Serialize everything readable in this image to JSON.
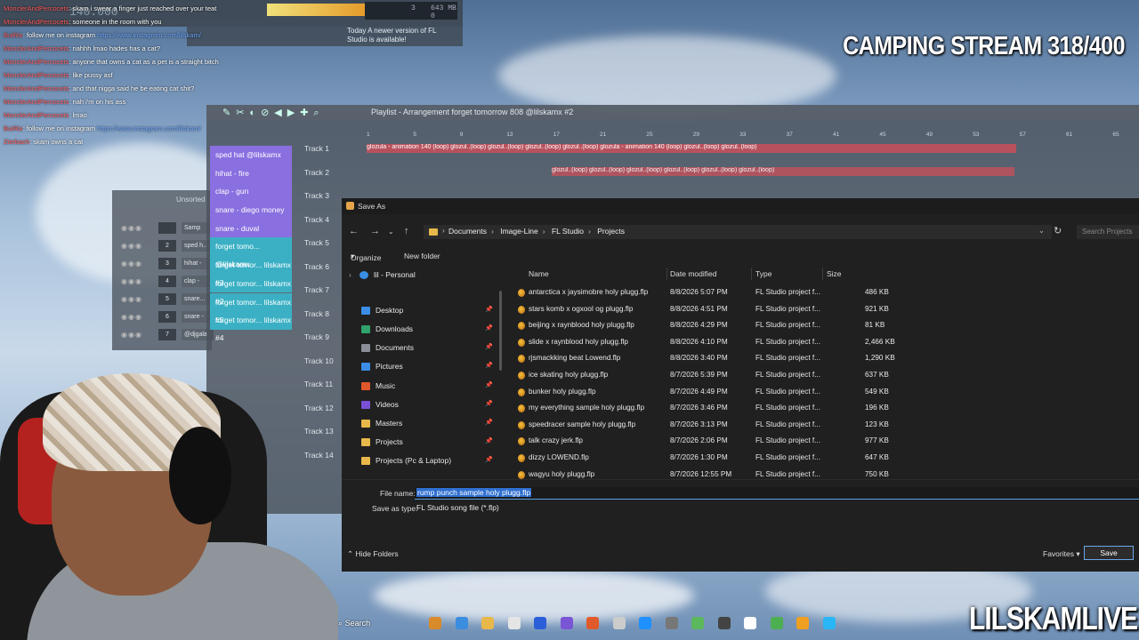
{
  "stream": {
    "title": "CAMPING STREAM 318/400",
    "brand": "LILSKAMLIVE"
  },
  "fl_top": {
    "counter_a": "3",
    "counter_b": "643 MB",
    "counter_c": "0",
    "newer_note": "Today A newer version of FL Studio is available!",
    "time_display": "140.000"
  },
  "chat": [
    {
      "user": "MonclerAndPercocets",
      "text": "skam i swear a finger just reached over your teat"
    },
    {
      "user": "MonclerAndPercocets",
      "text": "someone in the room with you"
    },
    {
      "user": "BuiRix",
      "text": "follow me on instagram",
      "link": "https://www.instagram.com/lilskam/"
    },
    {
      "user": "MonclerAndPercocets",
      "text": "nahhh lmao hades has a cat?"
    },
    {
      "user": "MonclerAndPercocets",
      "text": "anyone that owns a cat as a pet is a straight bitch"
    },
    {
      "user": "MonclerAndPercocets",
      "text": "like pussy asf"
    },
    {
      "user": "MonclerAndPercocets",
      "text": "and that nigga said he be eating cat shit?"
    },
    {
      "user": "MonclerAndPercocets",
      "text": "nah i'm on his ass"
    },
    {
      "user": "MonclerAndPercocets",
      "text": "lmao"
    },
    {
      "user": "BuiRix",
      "text": "follow me on instagram",
      "link": "https://www.instagram.com/lilskam/"
    },
    {
      "user": "Zierbach",
      "text": "skam owns a cat"
    }
  ],
  "playlist": {
    "title": "Playlist - Arrangement  forget tomorrow 808 @lilskamx #2",
    "patterns": [
      {
        "label": "sped hat @lilskamx",
        "style": "purple"
      },
      {
        "label": "hihat - fire",
        "style": "purple"
      },
      {
        "label": "clap - gun",
        "style": "purple"
      },
      {
        "label": "snare - diego money",
        "style": "purple"
      },
      {
        "label": "snare - duval",
        "style": "purple"
      },
      {
        "label": "forget tomo... @lilskamx",
        "style": "cyan"
      },
      {
        "label": "forget tomor... lilskamx #3",
        "style": "cyan"
      },
      {
        "label": "forget tomor... lilskamx #2",
        "style": "cyan"
      },
      {
        "label": "forget tomor... lilskamx #5",
        "style": "cyan"
      },
      {
        "label": "forget tomor... lilskamx #4",
        "style": "cyan"
      }
    ],
    "tracks": [
      "Track 1",
      "Track 2",
      "Track 3",
      "Track 4",
      "Track 5",
      "Track 6",
      "Track 7",
      "Track 8",
      "Track 9",
      "Track 10",
      "Track 11",
      "Track 12",
      "Track 13",
      "Track 14"
    ],
    "ruler": [
      "1",
      "5",
      "9",
      "13",
      "17",
      "21",
      "25",
      "29",
      "33",
      "37",
      "41",
      "45",
      "49",
      "53",
      "57",
      "61",
      "65"
    ],
    "clip_track1": "glozula - animation 140 (loop)   glozul..(loop)  glozul..(loop)  glozul..(loop)  glozul..(loop)  glozula - animation 140 (loop)   glozul..(loop)  glozul..(loop)",
    "clip_track2": "glozul..(loop)  glozul..(loop)  glozul..(loop)  glozul..(loop)   glozul..(loop)  glozul..(loop)"
  },
  "rack": {
    "title": "Unsorted",
    "rows": [
      {
        "num": "",
        "name": "Samp"
      },
      {
        "num": "2",
        "name": "sped h..."
      },
      {
        "num": "3",
        "name": "hihat -"
      },
      {
        "num": "4",
        "name": "clap -"
      },
      {
        "num": "5",
        "name": "snare..."
      },
      {
        "num": "6",
        "name": "snare -"
      },
      {
        "num": "7",
        "name": "@djgala"
      }
    ]
  },
  "dialog": {
    "title": "Save As",
    "breadcrumbs": [
      "Documents",
      "Image-Line",
      "FL Studio",
      "Projects"
    ],
    "search_placeholder": "Search Projects",
    "organize": "Organize",
    "new_folder": "New folder",
    "nav_top": "lil - Personal",
    "nav": [
      "Desktop",
      "Downloads",
      "Documents",
      "Pictures",
      "Music",
      "Videos",
      "Masters",
      "Projects",
      "Projects (Pc & Laptop)"
    ],
    "nav_colors": [
      "#3a8ee6",
      "#2fa36b",
      "#8a8f99",
      "#3a8ee6",
      "#e0572b",
      "#7a4fd6",
      "#e8b84a",
      "#e8b84a",
      "#e8b84a"
    ],
    "columns": {
      "name": "Name",
      "date": "Date modified",
      "type": "Type",
      "size": "Size"
    },
    "files": [
      {
        "name": "antarctica x jaysimobre holy plugg.flp",
        "date": "8/8/2026 5:07 PM",
        "type": "FL Studio project f...",
        "size": "486 KB"
      },
      {
        "name": "stars komb x ogxool og plugg.flp",
        "date": "8/8/2026 4:51 PM",
        "type": "FL Studio project f...",
        "size": "921 KB"
      },
      {
        "name": "beijing x raynblood holy plugg.flp",
        "date": "8/8/2026 4:29 PM",
        "type": "FL Studio project f...",
        "size": "81 KB"
      },
      {
        "name": "slide x raynblood holy plugg.flp",
        "date": "8/8/2026 4:10 PM",
        "type": "FL Studio project f...",
        "size": "2,466 KB"
      },
      {
        "name": "rjsmackking beat Lowend.flp",
        "date": "8/8/2026 3:40 PM",
        "type": "FL Studio project f...",
        "size": "1,290 KB"
      },
      {
        "name": "ice skating holy plugg.flp",
        "date": "8/7/2026 5:39 PM",
        "type": "FL Studio project f...",
        "size": "637 KB"
      },
      {
        "name": "bunker holy plugg.flp",
        "date": "8/7/2026 4:49 PM",
        "type": "FL Studio project f...",
        "size": "549 KB"
      },
      {
        "name": "my everything sample holy plugg.flp",
        "date": "8/7/2026 3:46 PM",
        "type": "FL Studio project f...",
        "size": "196 KB"
      },
      {
        "name": "speedracer sample holy plugg.flp",
        "date": "8/7/2026 3:13 PM",
        "type": "FL Studio project f...",
        "size": "123 KB"
      },
      {
        "name": "talk crazy jerk.flp",
        "date": "8/7/2026 2:06 PM",
        "type": "FL Studio project f...",
        "size": "977 KB"
      },
      {
        "name": "dizzy LOWEND.flp",
        "date": "8/7/2026 1:30 PM",
        "type": "FL Studio project f...",
        "size": "647 KB"
      },
      {
        "name": "wagyu holy plugg.flp",
        "date": "8/7/2026 12:55 PM",
        "type": "FL Studio project f...",
        "size": "750 KB"
      }
    ],
    "file_name_label": "File name:",
    "file_name_value": "rump punch sample holy plugg.flp",
    "save_type_label": "Save as type:",
    "save_type_value": "FL Studio song file (*.flp)",
    "hide_folders": "Hide Folders",
    "favorites": "Favorites",
    "save": "Save"
  },
  "taskbar": {
    "search": "Search",
    "icon_colors": [
      "#d98a2b",
      "#3b8de0",
      "#e8b84a",
      "#e5e5e5",
      "#2b5fd9",
      "#7a55d6",
      "#e05a2b",
      "#cccccc",
      "#1e90ff",
      "#777777",
      "#5cb85c",
      "#444444",
      "#ffffff",
      "#4caf50",
      "#f0a020",
      "#29b6f6"
    ]
  }
}
